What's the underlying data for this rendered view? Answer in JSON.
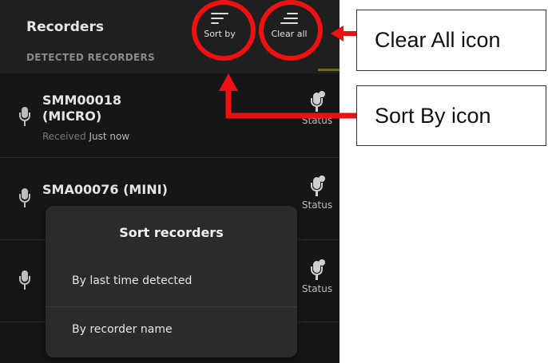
{
  "header": {
    "title": "Recorders",
    "section_label": "DETECTED RECORDERS",
    "sort_label": "Sort by",
    "clear_label": "Clear all"
  },
  "recorders": [
    {
      "name_line1": "SMM00018",
      "name_line2": "(MICRO)",
      "sub_prefix": "Received",
      "sub_value": "Just now",
      "status": "Status"
    },
    {
      "name_line1": "SMA00076 (MINI)",
      "name_line2": "",
      "sub_prefix": "",
      "sub_value": "",
      "status": "Status"
    },
    {
      "name_line1": "",
      "name_line2": "",
      "sub_prefix": "",
      "sub_value": "",
      "status": "Status"
    }
  ],
  "popup": {
    "title": "Sort recorders",
    "options": [
      "By last time detected",
      "By recorder name"
    ]
  },
  "annotations": {
    "clear_all": "Clear All icon",
    "sort_by": "Sort By icon",
    "highlight_color": "#ee1111"
  }
}
